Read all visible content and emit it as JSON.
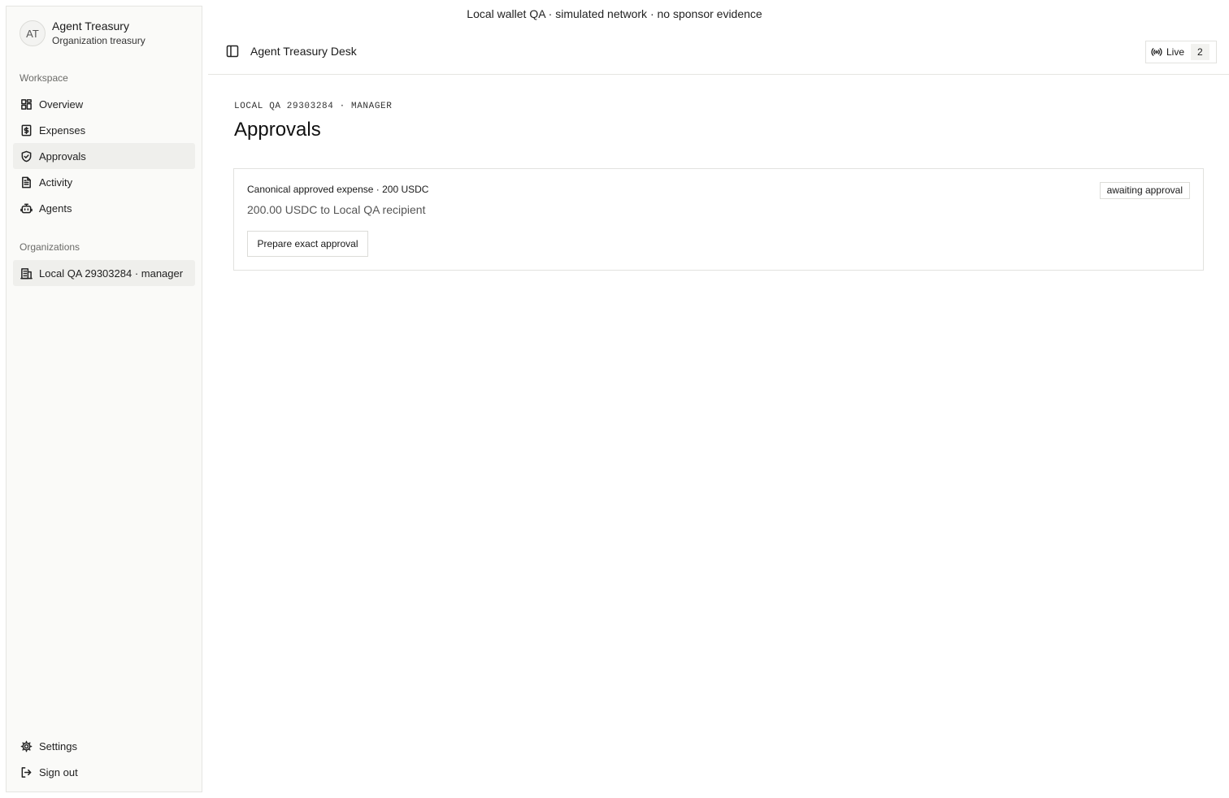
{
  "banner": "Local wallet QA · simulated network · no sponsor evidence",
  "brand": {
    "initials": "AT",
    "name": "Agent Treasury",
    "subtitle": "Organization treasury"
  },
  "sidebar": {
    "workspace_label": "Workspace",
    "items": [
      {
        "label": "Overview",
        "icon": "grid-icon"
      },
      {
        "label": "Expenses",
        "icon": "receipt-icon"
      },
      {
        "label": "Approvals",
        "icon": "shield-check-icon",
        "active": true
      },
      {
        "label": "Activity",
        "icon": "document-icon"
      },
      {
        "label": "Agents",
        "icon": "bot-icon"
      }
    ],
    "organizations_label": "Organizations",
    "org": {
      "label": "Local QA 29303284 · manager",
      "icon": "building-icon"
    },
    "settings_label": "Settings",
    "signout_label": "Sign out"
  },
  "header": {
    "title": "Agent Treasury Desk",
    "live_label": "Live",
    "live_count": "2"
  },
  "main": {
    "eyebrow": "LOCAL QA 29303284 · MANAGER",
    "title": "Approvals",
    "card": {
      "title": "Canonical approved expense · 200 USDC",
      "subtitle": "200.00 USDC to Local QA recipient",
      "status": "awaiting approval",
      "action_label": "Prepare exact approval"
    }
  }
}
